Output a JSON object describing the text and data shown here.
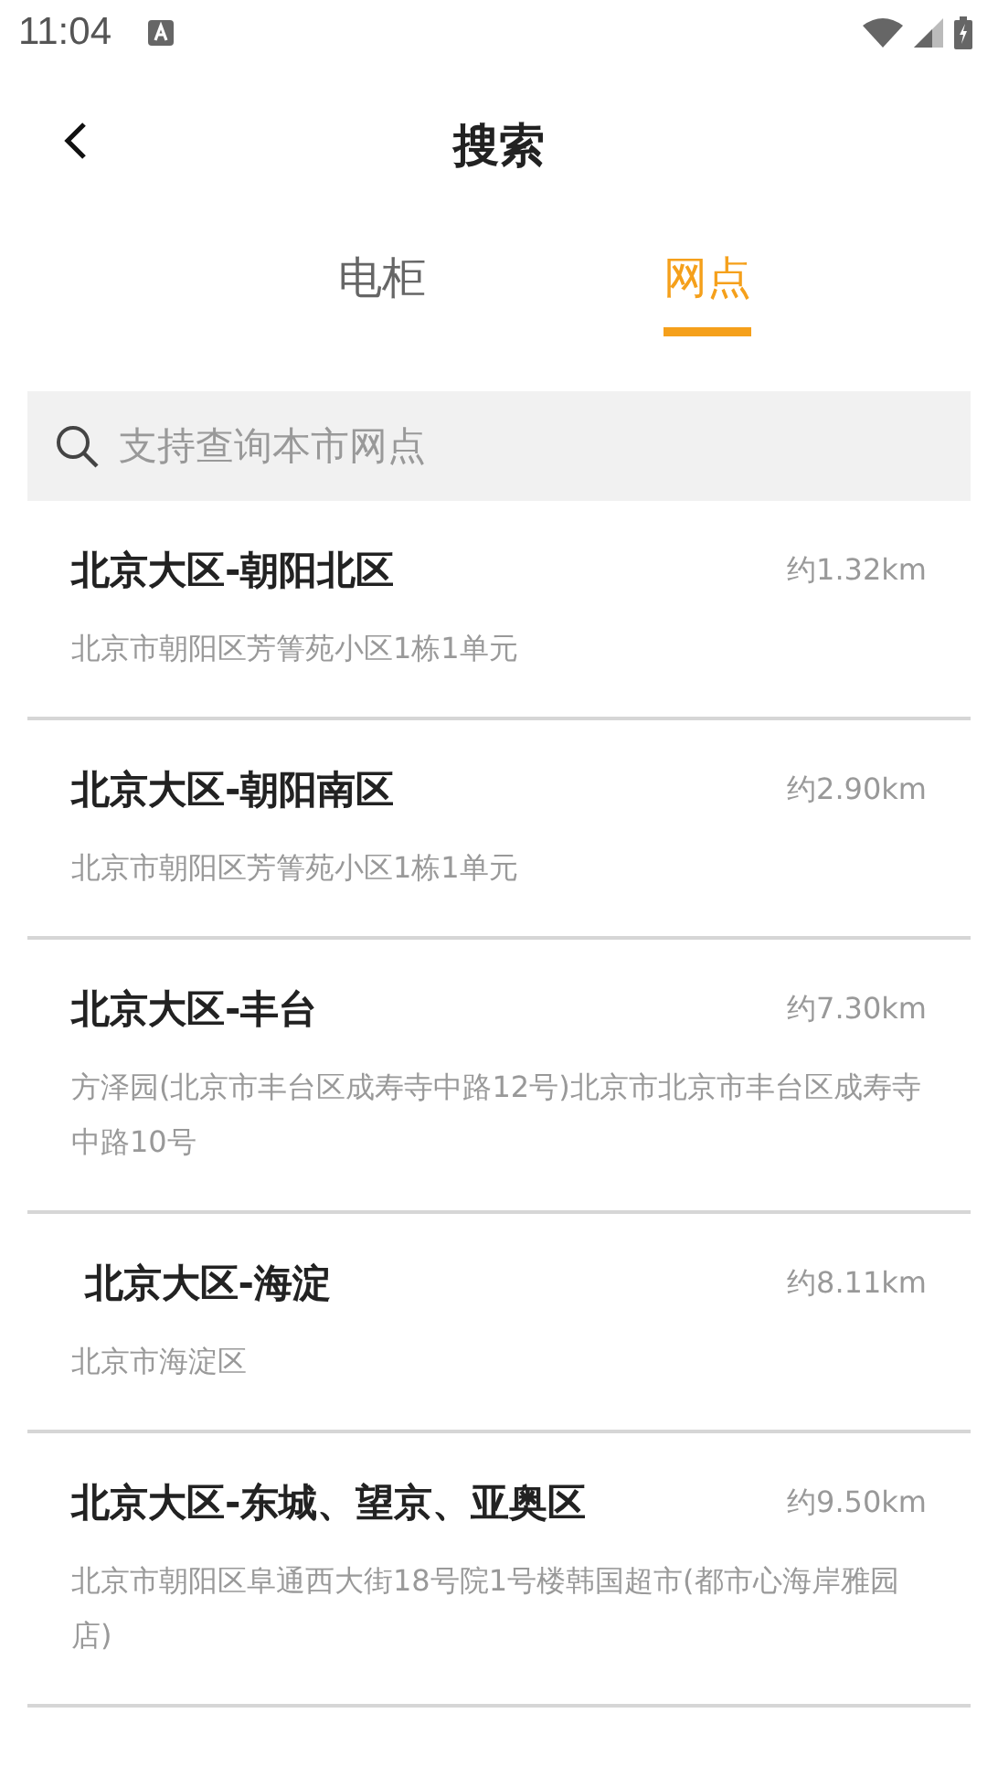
{
  "status_bar": {
    "time": "11:04"
  },
  "header": {
    "title": "搜索"
  },
  "tabs": [
    {
      "label": "电柜",
      "selected": false
    },
    {
      "label": "网点",
      "selected": true
    }
  ],
  "search": {
    "placeholder": "支持查询本市网点"
  },
  "results": [
    {
      "name": "北京大区-朝阳北区",
      "distance": "约1.32km",
      "address": "北京市朝阳区芳箐苑小区1栋1单元"
    },
    {
      "name": "北京大区-朝阳南区",
      "distance": "约2.90km",
      "address": "北京市朝阳区芳箐苑小区1栋1单元"
    },
    {
      "name": "北京大区-丰台",
      "distance": "约7.30km",
      "address": "方泽园(北京市丰台区成寿寺中路12号)北京市北京市丰台区成寿寺中路10号"
    },
    {
      "name": " 北京大区-海淀",
      "distance": "约8.11km",
      "address": "北京市海淀区"
    },
    {
      "name": "北京大区-东城、望京、亚奥区",
      "distance": "约9.50km",
      "address": "北京市朝阳区阜通西大街18号院1号楼韩国超市(都市心海岸雅园店)"
    }
  ]
}
